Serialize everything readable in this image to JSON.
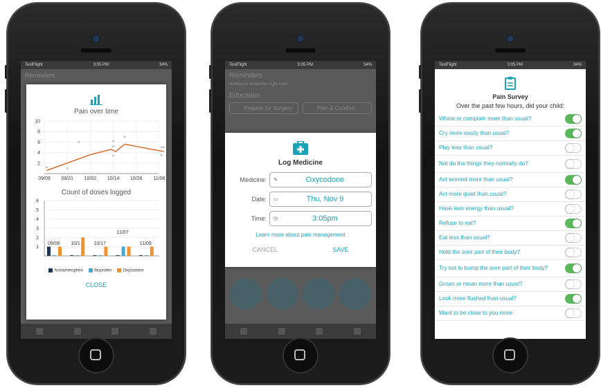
{
  "phone1": {
    "status": {
      "carrier": "TestFlight",
      "time": "3:05 PM",
      "battery": "34%"
    },
    "bg_title": "Reminders",
    "pain_chart_title": "Pain over time",
    "dose_chart_title": "Count of doses logged",
    "close_label": "CLOSE",
    "chart_data": [
      {
        "type": "scatter",
        "title": "Pain over time",
        "xlabel": "",
        "ylabel": "",
        "x_ticks": [
          "09/09",
          "09/21",
          "10/02",
          "10/14",
          "10/26",
          "11/06"
        ],
        "y_ticks": [
          2,
          4,
          6,
          8,
          10
        ],
        "ylim": [
          0,
          10
        ],
        "series": [
          {
            "values": [
              [
                0.1,
                1.2
              ],
              [
                1.0,
                1.0
              ],
              [
                1.5,
                6.0
              ],
              [
                3.0,
                6.2
              ],
              [
                3.0,
                3.4
              ],
              [
                3.0,
                5.2
              ],
              [
                3.5,
                7.0
              ],
              [
                5.1,
                5.0
              ],
              [
                5.1,
                3.5
              ],
              [
                5.2,
                5.0
              ]
            ]
          },
          {
            "values": [
              [
                0.1,
                0.6
              ],
              [
                1.0,
                2.0
              ],
              [
                2.0,
                3.6
              ],
              [
                2.9,
                4.6
              ],
              [
                3.1,
                4.2
              ],
              [
                3.5,
                5.6
              ],
              [
                4.2,
                5.0
              ],
              [
                5.2,
                4.2
              ]
            ]
          }
        ],
        "grid": true
      },
      {
        "type": "bar",
        "title": "Count of doses logged",
        "categories": [
          "09/06",
          "10/1",
          "10/17",
          "11/07",
          "11/09"
        ],
        "ylim": [
          0,
          6
        ],
        "y_ticks": [
          1,
          2,
          3,
          4,
          5,
          6
        ],
        "series": [
          {
            "name": "Acetaminophen",
            "values": [
              1,
              0,
              0,
              0,
              0
            ]
          },
          {
            "name": "Ibuprofen",
            "values": [
              0,
              0,
              0,
              1,
              0
            ]
          },
          {
            "name": "Oxycodone",
            "values": [
              1,
              2,
              1,
              1,
              1
            ]
          }
        ],
        "legend": "bottom",
        "grid": true
      }
    ],
    "colors": {
      "accent": "#1aa3b8",
      "acetaminophen": "#1f3556",
      "ibuprofen": "#4aa8d0",
      "oxycodone": "#f0922e",
      "line": "#d9753a"
    }
  },
  "phone2": {
    "status": {
      "carrier": "TestFlight",
      "time": "3:05 PM",
      "battery": "34%"
    },
    "bg": {
      "reminders": "Reminders",
      "reminders_sub": "Nothing to remember right now!",
      "education": "Education",
      "btn1": "Prepare for Surgery",
      "btn2": "Pain & Comfort"
    },
    "title": "Log Medicine",
    "fields": [
      {
        "label": "Medicine:",
        "icon": "pill-icon",
        "value": "Oxycodone"
      },
      {
        "label": "Date:",
        "icon": "calendar-icon",
        "value": "Thu, Nov 9"
      },
      {
        "label": "Time:",
        "icon": "clock-icon",
        "value": "3:05pm"
      }
    ],
    "learn_more": "Learn more about pain management",
    "cancel": "CANCEL",
    "save": "SAVE"
  },
  "phone3": {
    "status": {
      "carrier": "TestFlight",
      "time": "3:05 PM",
      "battery": "34%"
    },
    "title": "Pain Survey",
    "subtitle": "Over the past few hours, did your child:",
    "questions": [
      {
        "text": "Whine or complain more than usual?",
        "on": true
      },
      {
        "text": "Cry more easily than usual?",
        "on": true
      },
      {
        "text": "Play less than usual?",
        "on": false
      },
      {
        "text": "Not do the things they normally do?",
        "on": false
      },
      {
        "text": "Act worried more than usual?",
        "on": true
      },
      {
        "text": "Act more quiet than usual?",
        "on": false
      },
      {
        "text": "Have less energy than usual?",
        "on": false
      },
      {
        "text": "Refuse to eat?",
        "on": true
      },
      {
        "text": "Eat less than usual?",
        "on": false
      },
      {
        "text": "Hold the sore part of their body?",
        "on": false
      },
      {
        "text": "Try not to bump the sore part of their body?",
        "on": true
      },
      {
        "text": "Groan or moan more than usual?",
        "on": false
      },
      {
        "text": "Look more flushed than usual?",
        "on": true
      },
      {
        "text": "Want to be close to you more",
        "on": false
      }
    ]
  }
}
